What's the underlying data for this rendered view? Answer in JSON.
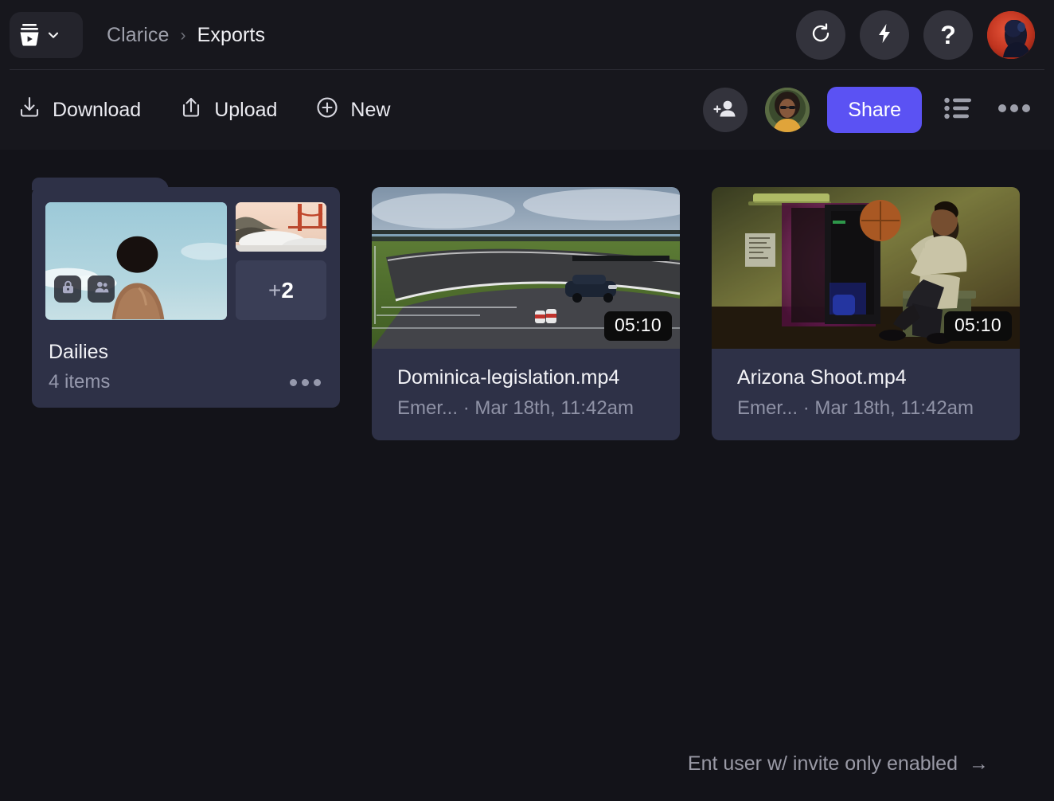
{
  "topbar": {
    "workspace_icon": "bucket-play-logo",
    "workspace_chevron_icon": "chevron-down-icon",
    "breadcrumb": {
      "root": "Clarice",
      "separator": "›",
      "current": "Exports"
    },
    "buttons": [
      {
        "name": "refresh-button",
        "icon": "refresh-icon",
        "label": ""
      },
      {
        "name": "lightning-button",
        "icon": "lightning-bolt-icon",
        "label": ""
      },
      {
        "name": "help-button",
        "icon": "question-mark-icon",
        "label": "?"
      }
    ],
    "avatar": {
      "name": "user-avatar",
      "alt": "User avatar"
    }
  },
  "actionbar": {
    "download_label": "Download",
    "download_icon": "download-icon",
    "upload_label": "Upload",
    "upload_icon": "upload-icon",
    "new_label": "New",
    "new_icon": "plus-circle-icon",
    "invite_icon": "add-person-icon",
    "collaborator_avatar": "collaborator-avatar",
    "share_label": "Share",
    "share_color": "#5b52f3",
    "view_toggle_icon": "list-view-icon",
    "overflow_icon": "more-horizontal-icon"
  },
  "items": [
    {
      "type": "folder",
      "title": "Dailies",
      "subtitle": "4 items",
      "overflow_count": "+2",
      "plus_sign": "+",
      "extra_count": "2",
      "badges": [
        "lock-icon",
        "people-icon"
      ],
      "menu_icon": "more-horizontal-icon"
    },
    {
      "type": "asset",
      "title": "Dominica-legislation.mp4",
      "subtitle": "Emer... · Mar 18th, 11:42am",
      "duration": "05:10"
    },
    {
      "type": "asset",
      "title": "Arizona Shoot.mp4",
      "subtitle": "Emer... · Mar 18th, 11:42am",
      "duration": "05:10"
    }
  ],
  "footer": {
    "hint_text": "Ent user w/ invite only enabled",
    "arrow": "→"
  },
  "colors": {
    "page_background": "#131319",
    "bar_background": "#17171d",
    "card_background": "#2e3147",
    "accent": "#5b52f3"
  }
}
